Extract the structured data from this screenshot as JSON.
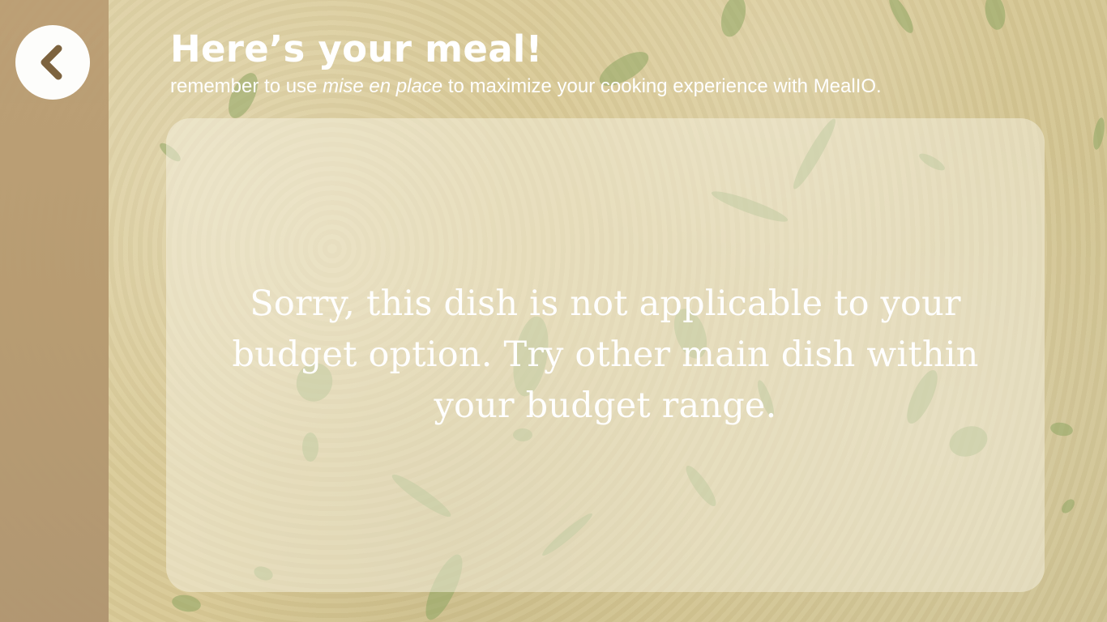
{
  "header": {
    "title": "Here’s your meal!",
    "subtitle_prefix": "remember to use ",
    "subtitle_italic": "mise en place",
    "subtitle_suffix": " to maximize your cooking experience with MealIO."
  },
  "message": {
    "text": "Sorry, this dish is not applicable to your budget option. Try other main dish within your budget range."
  },
  "icons": {
    "back": "chevron-left-icon"
  },
  "colors": {
    "background": "#d8c894",
    "sidebar": "#b69a70",
    "text": "#ffffff",
    "card": "#f5f1e2",
    "chevron": "#7a5f3a",
    "leaf": "#8aa060"
  }
}
